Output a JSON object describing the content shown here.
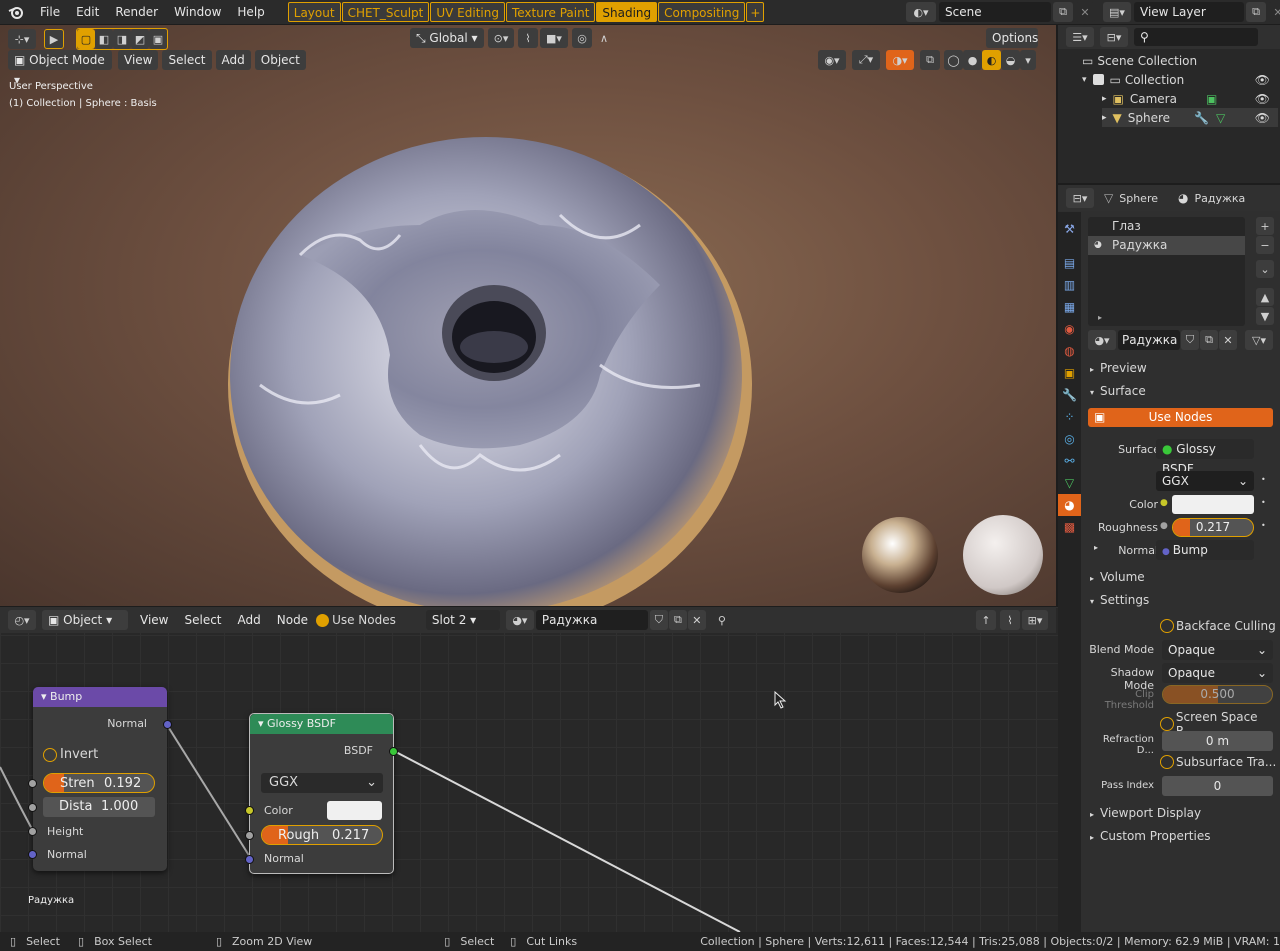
{
  "top_menu": {
    "app_icon": "blender-logo-icon",
    "items": [
      "File",
      "Edit",
      "Render",
      "Window",
      "Help"
    ]
  },
  "workspaces": {
    "tabs": [
      "Layout",
      "CHET_Sculpt",
      "UV Editing",
      "Texture Paint",
      "Shading",
      "Compositing"
    ],
    "active": "Shading",
    "add_label": "+"
  },
  "scene": {
    "icon": "scene-icon",
    "value": "Scene"
  },
  "view_layer": {
    "icon": "view-layer-icon",
    "value": "View Layer"
  },
  "viewport": {
    "transform_orientation": "Global",
    "options_label": "Options",
    "mode": "Object Mode",
    "menus": [
      "View",
      "Select",
      "Add",
      "Object"
    ],
    "overlay_line1": "User Perspective",
    "overlay_line2": "(1) Collection | Sphere : Basis"
  },
  "node_editor": {
    "editor_type": "Object",
    "menus": [
      "View",
      "Select",
      "Add",
      "Node"
    ],
    "use_nodes_label": "Use Nodes",
    "slot": "Slot 2",
    "material": "Радужка",
    "footer_material": "Радужка",
    "bump": {
      "title": "Bump",
      "out_normal": "Normal",
      "invert": "Invert",
      "strength_label": "Stren",
      "strength": "0.192",
      "distance_label": "Dista",
      "distance": "1.000",
      "height": "Height",
      "normal": "Normal"
    },
    "glossy": {
      "title": "Glossy BSDF",
      "out_bsdf": "BSDF",
      "distribution": "GGX",
      "color": "Color",
      "roughness_label": "Rough",
      "roughness": "0.217",
      "normal": "Normal"
    }
  },
  "outliner": {
    "search_placeholder": "",
    "root": "Scene Collection",
    "items": [
      {
        "label": "Collection"
      },
      {
        "label": "Camera"
      },
      {
        "label": "Sphere"
      }
    ]
  },
  "properties": {
    "object_name": "Sphere",
    "material_name": "Радужка",
    "slots": [
      "Глаз",
      "Радужка"
    ],
    "active_slot": "Радужка",
    "material_field": "Радужка",
    "sections": {
      "preview": "Preview",
      "surface": "Surface",
      "volume": "Volume",
      "settings": "Settings",
      "viewport_display": "Viewport Display",
      "custom_properties": "Custom Properties"
    },
    "use_nodes_button": "Use Nodes",
    "surface_label": "Surface",
    "surface_value": "Glossy BSDF",
    "distribution": "GGX",
    "color_label": "Color",
    "roughness_label": "Roughness",
    "roughness": "0.217",
    "roughness_fraction": 0.217,
    "normal_label": "Normal",
    "normal_value": "Bump",
    "backface_culling": "Backface Culling",
    "blend_mode_label": "Blend Mode",
    "blend_mode": "Opaque",
    "shadow_mode_label": "Shadow Mode",
    "shadow_mode": "Opaque",
    "clip_threshold_label": "Clip Threshold",
    "clip_threshold": "0.500",
    "clip_fraction": 0.5,
    "screen_space": "Screen Space R...",
    "refraction_label": "Refraction D...",
    "refraction_value": "0 m",
    "subsurface": "Subsurface Tra...",
    "pass_index_label": "Pass Index",
    "pass_index": "0"
  },
  "status_bar": {
    "select": "Select",
    "box_select": "Box Select",
    "zoom": "Zoom 2D View",
    "select2": "Select",
    "cut_links": "Cut Links",
    "stats": "Collection | Sphere | Verts:12,611 | Faces:12,544 | Tris:25,088 | Objects:0/2 | Memory: 62.9 MiB | VRAM: 1"
  },
  "colors": {
    "accent": "#e0a000",
    "active_tab": "#e0a000",
    "use_nodes": "#e0641a",
    "bump_header": "#6b4aa8",
    "glossy_header": "#2e8b57",
    "socket_yellow": "#c7c729",
    "socket_grey": "#a1a1a1",
    "socket_purple": "#6363c7",
    "socket_green": "#39c739"
  }
}
